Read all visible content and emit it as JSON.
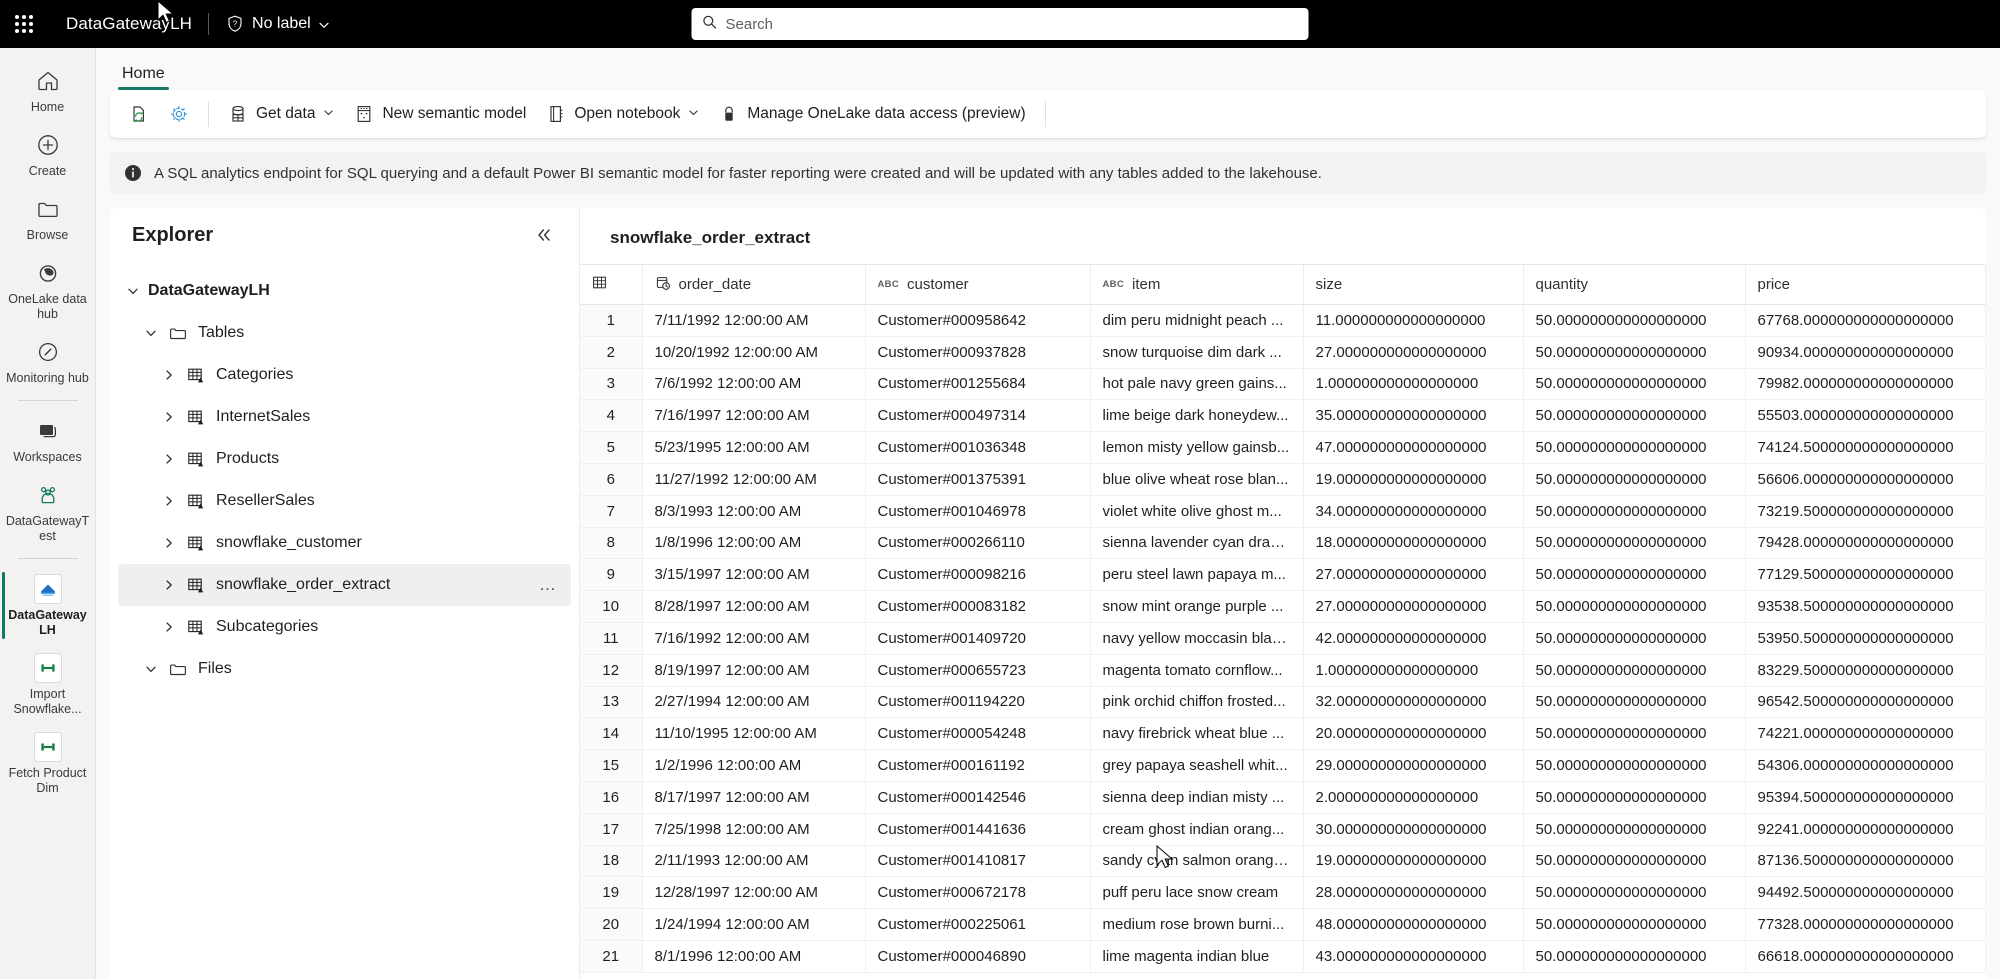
{
  "topbar": {
    "waffle_name": "app-launcher",
    "brand": "DataGatewayLH",
    "sensitivity_label": "No label",
    "search_placeholder": "Search",
    "search_value": ""
  },
  "ribbon": {
    "tabs": [
      {
        "label": "Home",
        "selected": true
      }
    ],
    "commands": [
      {
        "name": "refresh-button",
        "label": "",
        "icon": "refresh-page-icon"
      },
      {
        "name": "settings-button",
        "label": "",
        "icon": "gear-icon"
      },
      {
        "name": "get-data-button",
        "label": "Get data",
        "icon": "database-icon",
        "caret": true
      },
      {
        "name": "new-semantic-model-button",
        "label": "New semantic model",
        "icon": "semantic-model-icon",
        "caret": false
      },
      {
        "name": "open-notebook-button",
        "label": "Open notebook",
        "icon": "notebook-icon",
        "caret": true
      },
      {
        "name": "manage-onelake-data-access-button",
        "label": "Manage OneLake data access (preview)",
        "icon": "lock-icon",
        "caret": false
      }
    ]
  },
  "banner": {
    "icon": "info-icon",
    "text": "A SQL analytics endpoint for SQL querying and a default Power BI semantic model for faster reporting were created and will be updated with any tables added to the lakehouse."
  },
  "rail": {
    "items": [
      {
        "label": "Home",
        "icon": "home-icon",
        "active": false
      },
      {
        "label": "Create",
        "icon": "plus-circle-icon",
        "active": false
      },
      {
        "label": "Browse",
        "icon": "folder-icon",
        "active": false
      },
      {
        "label": "OneLake data hub",
        "icon": "onelake-icon",
        "active": false
      },
      {
        "label": "Monitoring hub",
        "icon": "monitoring-icon",
        "active": false
      },
      {
        "label": "Workspaces",
        "icon": "workspaces-icon",
        "active": false
      },
      {
        "label": "DataGatewayTest",
        "icon": "workspace-group-icon",
        "active": false
      },
      {
        "label": "DataGatewayLH",
        "icon": "lakehouse-icon",
        "active": true
      },
      {
        "label": "Import Snowflake...",
        "icon": "pipeline-icon",
        "active": false
      },
      {
        "label": "Fetch Product Dim",
        "icon": "pipeline-icon",
        "active": false
      }
    ]
  },
  "explorer": {
    "title": "Explorer",
    "collapse_icon": "collapse-panel-icon",
    "tree": [
      {
        "label": "DataGatewayLH",
        "level": 0,
        "icon": "",
        "twisty": "chevron-down-icon",
        "selected": false,
        "bold": true
      },
      {
        "label": "Tables",
        "level": 1,
        "icon": "folder-icon",
        "twisty": "chevron-down-icon",
        "selected": false,
        "bold": false
      },
      {
        "label": "Categories",
        "level": 2,
        "icon": "table-icon",
        "twisty": "chevron-right-icon",
        "selected": false,
        "bold": false
      },
      {
        "label": "InternetSales",
        "level": 2,
        "icon": "table-icon",
        "twisty": "chevron-right-icon",
        "selected": false,
        "bold": false
      },
      {
        "label": "Products",
        "level": 2,
        "icon": "table-icon",
        "twisty": "chevron-right-icon",
        "selected": false,
        "bold": false
      },
      {
        "label": "ResellerSales",
        "level": 2,
        "icon": "table-icon",
        "twisty": "chevron-right-icon",
        "selected": false,
        "bold": false
      },
      {
        "label": "snowflake_customer",
        "level": 2,
        "icon": "table-icon",
        "twisty": "chevron-right-icon",
        "selected": false,
        "bold": false
      },
      {
        "label": "snowflake_order_extract",
        "level": 2,
        "icon": "table-icon",
        "twisty": "chevron-right-icon",
        "selected": true,
        "bold": false,
        "overflow": "…"
      },
      {
        "label": "Subcategories",
        "level": 2,
        "icon": "table-icon",
        "twisty": "chevron-right-icon",
        "selected": false,
        "bold": false
      },
      {
        "label": "Files",
        "level": 1,
        "icon": "folder-icon",
        "twisty": "chevron-down-icon",
        "selected": false,
        "bold": false
      }
    ]
  },
  "preview": {
    "table_name": "snowflake_order_extract",
    "columns": [
      {
        "key": "rownum",
        "label": "",
        "type": ""
      },
      {
        "key": "order_date",
        "label": "order_date",
        "type": "datetime"
      },
      {
        "key": "customer",
        "label": "customer",
        "type": "ABC"
      },
      {
        "key": "item",
        "label": "item",
        "type": "ABC"
      },
      {
        "key": "size",
        "label": "size",
        "type": ""
      },
      {
        "key": "quantity",
        "label": "quantity",
        "type": ""
      },
      {
        "key": "price",
        "label": "price",
        "type": ""
      }
    ],
    "rows": [
      {
        "n": "1",
        "order_date": "7/11/1992 12:00:00 AM",
        "customer": "Customer#000958642",
        "item": "dim peru midnight peach ...",
        "size": "11.000000000000000000",
        "quantity": "50.000000000000000000",
        "price": "67768.000000000000000000"
      },
      {
        "n": "2",
        "order_date": "10/20/1992 12:00:00 AM",
        "customer": "Customer#000937828",
        "item": "snow turquoise dim dark ...",
        "size": "27.000000000000000000",
        "quantity": "50.000000000000000000",
        "price": "90934.000000000000000000"
      },
      {
        "n": "3",
        "order_date": "7/6/1992 12:00:00 AM",
        "customer": "Customer#001255684",
        "item": "hot pale navy green gains...",
        "size": "1.000000000000000000",
        "quantity": "50.000000000000000000",
        "price": "79982.000000000000000000"
      },
      {
        "n": "4",
        "order_date": "7/16/1997 12:00:00 AM",
        "customer": "Customer#000497314",
        "item": "lime beige dark honeydew...",
        "size": "35.000000000000000000",
        "quantity": "50.000000000000000000",
        "price": "55503.000000000000000000"
      },
      {
        "n": "5",
        "order_date": "5/23/1995 12:00:00 AM",
        "customer": "Customer#001036348",
        "item": "lemon misty yellow gainsb...",
        "size": "47.000000000000000000",
        "quantity": "50.000000000000000000",
        "price": "74124.500000000000000000"
      },
      {
        "n": "6",
        "order_date": "11/27/1992 12:00:00 AM",
        "customer": "Customer#001375391",
        "item": "blue olive wheat rose blan...",
        "size": "19.000000000000000000",
        "quantity": "50.000000000000000000",
        "price": "56606.000000000000000000"
      },
      {
        "n": "7",
        "order_date": "8/3/1993 12:00:00 AM",
        "customer": "Customer#001046978",
        "item": "violet white olive ghost m...",
        "size": "34.000000000000000000",
        "quantity": "50.000000000000000000",
        "price": "73219.500000000000000000"
      },
      {
        "n": "8",
        "order_date": "1/8/1996 12:00:00 AM",
        "customer": "Customer#000266110",
        "item": "sienna lavender cyan drab ...",
        "size": "18.000000000000000000",
        "quantity": "50.000000000000000000",
        "price": "79428.000000000000000000"
      },
      {
        "n": "9",
        "order_date": "3/15/1997 12:00:00 AM",
        "customer": "Customer#000098216",
        "item": "peru steel lawn papaya m...",
        "size": "27.000000000000000000",
        "quantity": "50.000000000000000000",
        "price": "77129.500000000000000000"
      },
      {
        "n": "10",
        "order_date": "8/28/1997 12:00:00 AM",
        "customer": "Customer#000083182",
        "item": "snow mint orange purple ...",
        "size": "27.000000000000000000",
        "quantity": "50.000000000000000000",
        "price": "93538.500000000000000000"
      },
      {
        "n": "11",
        "order_date": "7/16/1992 12:00:00 AM",
        "customer": "Customer#001409720",
        "item": "navy yellow moccasin blan...",
        "size": "42.000000000000000000",
        "quantity": "50.000000000000000000",
        "price": "53950.500000000000000000"
      },
      {
        "n": "12",
        "order_date": "8/19/1997 12:00:00 AM",
        "customer": "Customer#000655723",
        "item": "magenta tomato cornflow...",
        "size": "1.000000000000000000",
        "quantity": "50.000000000000000000",
        "price": "83229.500000000000000000"
      },
      {
        "n": "13",
        "order_date": "2/27/1994 12:00:00 AM",
        "customer": "Customer#001194220",
        "item": "pink orchid chiffon frosted...",
        "size": "32.000000000000000000",
        "quantity": "50.000000000000000000",
        "price": "96542.500000000000000000"
      },
      {
        "n": "14",
        "order_date": "11/10/1995 12:00:00 AM",
        "customer": "Customer#000054248",
        "item": "navy firebrick wheat blue ...",
        "size": "20.000000000000000000",
        "quantity": "50.000000000000000000",
        "price": "74221.000000000000000000"
      },
      {
        "n": "15",
        "order_date": "1/2/1996 12:00:00 AM",
        "customer": "Customer#000161192",
        "item": "grey papaya seashell whit...",
        "size": "29.000000000000000000",
        "quantity": "50.000000000000000000",
        "price": "54306.000000000000000000"
      },
      {
        "n": "16",
        "order_date": "8/17/1997 12:00:00 AM",
        "customer": "Customer#000142546",
        "item": "sienna deep indian misty ...",
        "size": "2.000000000000000000",
        "quantity": "50.000000000000000000",
        "price": "95394.500000000000000000"
      },
      {
        "n": "17",
        "order_date": "7/25/1998 12:00:00 AM",
        "customer": "Customer#001441636",
        "item": "cream ghost indian orang...",
        "size": "30.000000000000000000",
        "quantity": "50.000000000000000000",
        "price": "92241.000000000000000000"
      },
      {
        "n": "18",
        "order_date": "2/11/1993 12:00:00 AM",
        "customer": "Customer#001410817",
        "item": "sandy cyan salmon orange...",
        "size": "19.000000000000000000",
        "quantity": "50.000000000000000000",
        "price": "87136.500000000000000000"
      },
      {
        "n": "19",
        "order_date": "12/28/1997 12:00:00 AM",
        "customer": "Customer#000672178",
        "item": "puff peru lace snow cream",
        "size": "28.000000000000000000",
        "quantity": "50.000000000000000000",
        "price": "94492.500000000000000000"
      },
      {
        "n": "20",
        "order_date": "1/24/1994 12:00:00 AM",
        "customer": "Customer#000225061",
        "item": "medium rose brown burni...",
        "size": "48.000000000000000000",
        "quantity": "50.000000000000000000",
        "price": "77328.000000000000000000"
      },
      {
        "n": "21",
        "order_date": "8/1/1996 12:00:00 AM",
        "customer": "Customer#000046890",
        "item": "lime magenta indian blue",
        "size": "43.000000000000000000",
        "quantity": "50.000000000000000000",
        "price": "66618.000000000000000000"
      }
    ]
  },
  "colors": {
    "accent": "#117865",
    "topbar_bg": "#000000",
    "rail_bg": "#f3f2f1",
    "surface": "#ffffff"
  }
}
